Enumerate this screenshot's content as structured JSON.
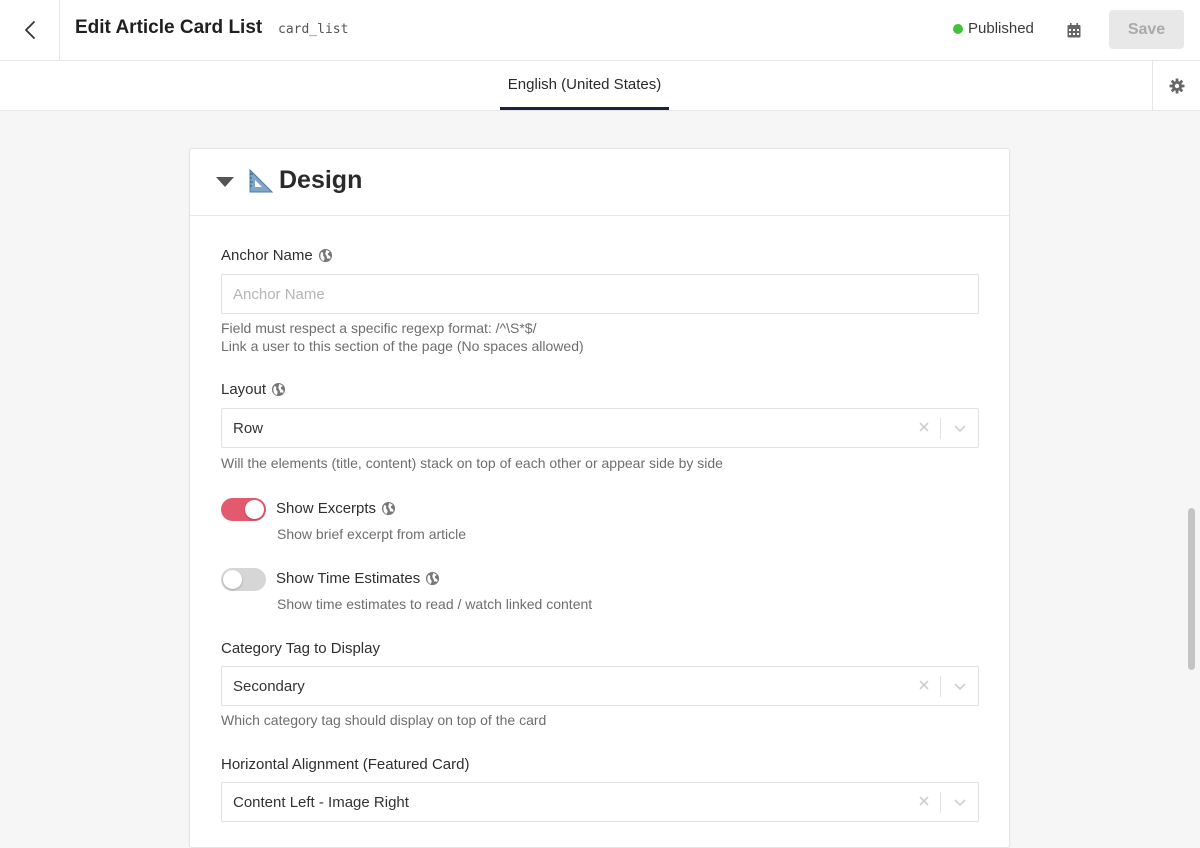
{
  "header": {
    "title": "Edit Article Card List",
    "api_id": "card_list",
    "status": "Published",
    "status_color": "#41c23a",
    "save_label": "Save"
  },
  "tabs": [
    {
      "label": "English (United States)",
      "active": true
    }
  ],
  "section": {
    "title": "Design",
    "icon": "triangular-ruler-icon"
  },
  "fields": {
    "anchor_name": {
      "label": "Anchor Name",
      "placeholder": "Anchor Name",
      "value": "",
      "help_1": "Field must respect a specific regexp format: /^\\S*$/",
      "help_2": "Link a user to this section of the page (No spaces allowed)"
    },
    "layout": {
      "label": "Layout",
      "value": "Row",
      "help": "Will the elements (title, content) stack on top of each other or appear side by side"
    },
    "show_excerpts": {
      "label": "Show Excerpts",
      "enabled": true,
      "help": "Show brief excerpt from article"
    },
    "show_time_estimates": {
      "label": "Show Time Estimates",
      "enabled": false,
      "help": "Show time estimates to read / watch linked content"
    },
    "category_tag": {
      "label": "Category Tag to Display",
      "value": "Secondary",
      "help": "Which category tag should display on top of the card"
    },
    "horizontal_alignment": {
      "label": "Horizontal Alignment (Featured Card)",
      "value": "Content Left - Image Right"
    }
  },
  "colors": {
    "toggle_on": "#e35a6f",
    "toggle_off": "#d6d6d6",
    "tab_underline": "#1c2340"
  }
}
